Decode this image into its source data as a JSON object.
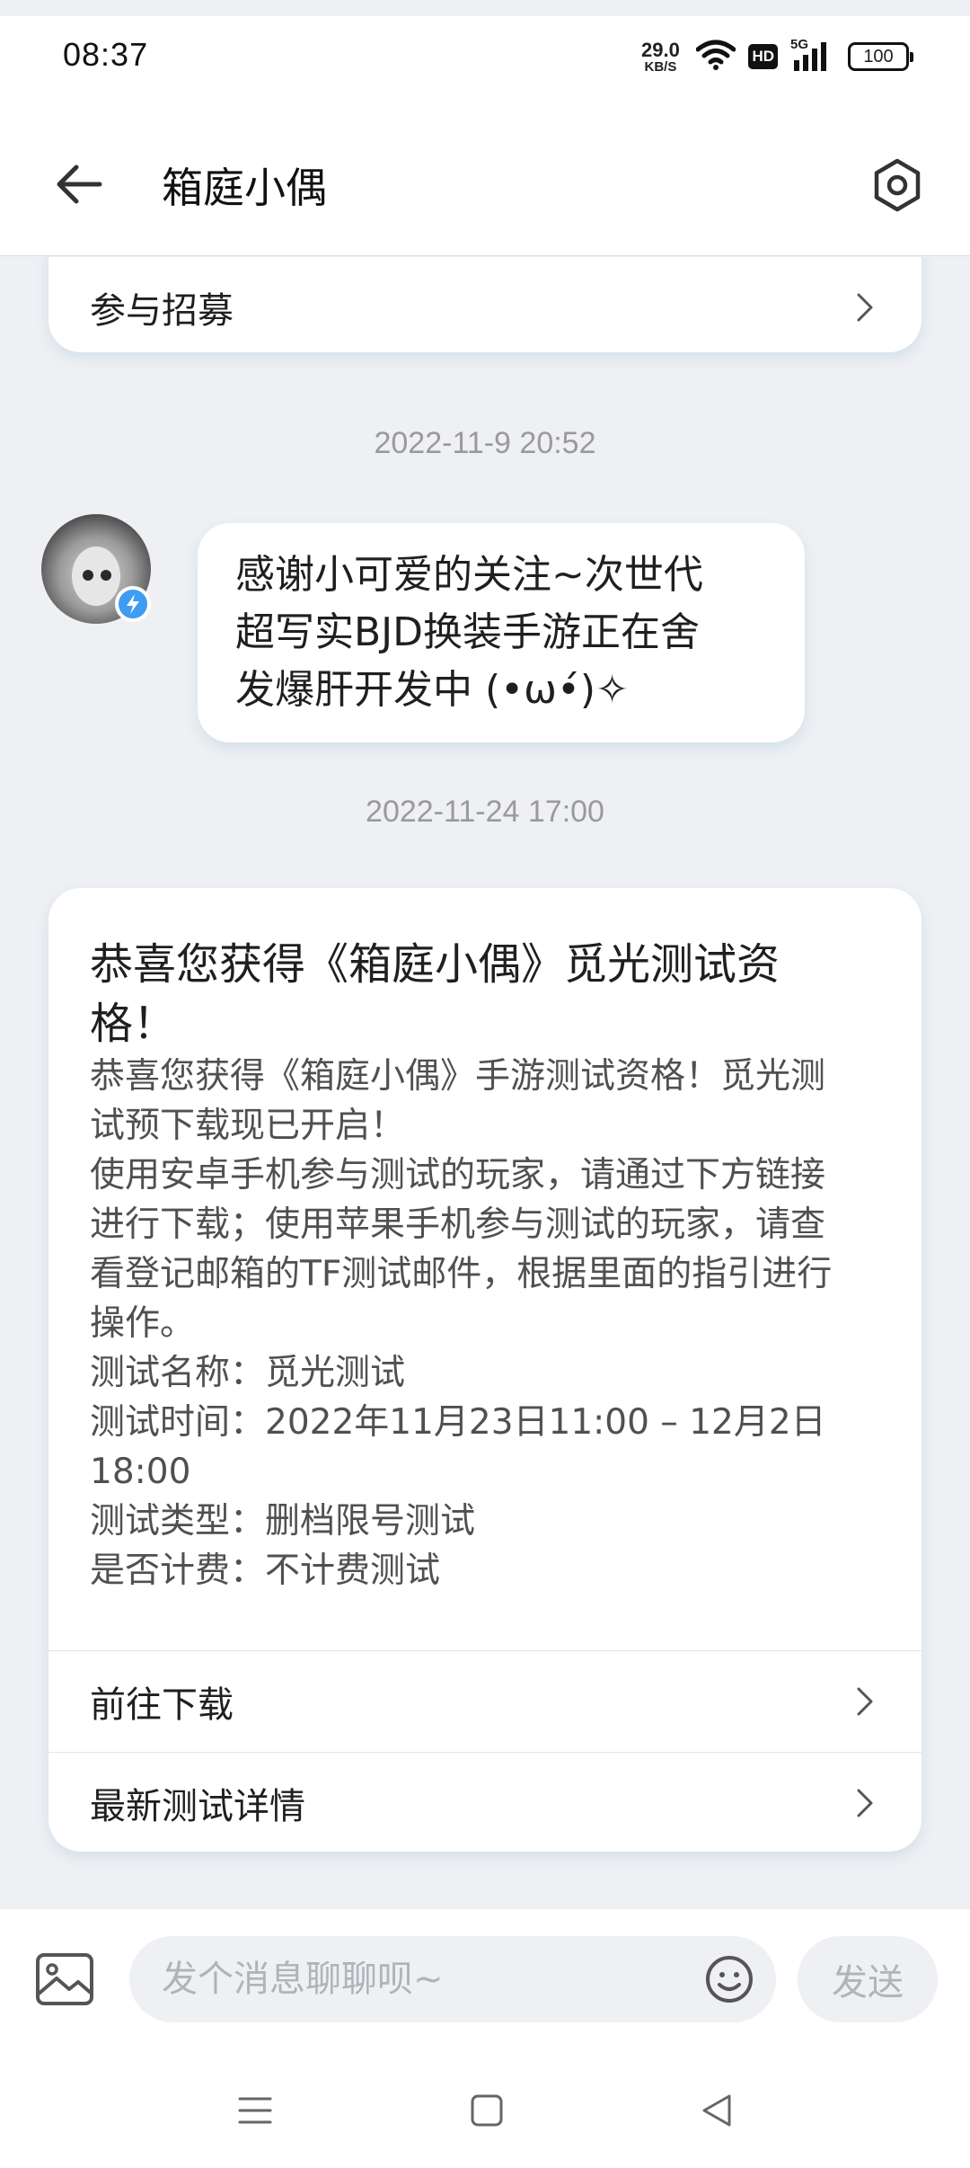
{
  "status_bar": {
    "time": "08:37",
    "net_speed_value": "29.0",
    "net_speed_unit": "KB/S",
    "hd": "HD",
    "network": "5G",
    "battery": "100"
  },
  "header": {
    "title": "箱庭小偶",
    "back_icon": "back-arrow-icon",
    "settings_icon": "hexagon-settings-icon"
  },
  "chat": {
    "top_card": {
      "label": "参与招募"
    },
    "messages": [
      {
        "timestamp": "2022-11-9 20:52",
        "lines": [
          "感谢小可爱的关注~次世代",
          "超写实BJD换装手游正在舍",
          "发爆肝开发中 (•ω•́)✧"
        ]
      }
    ],
    "notice": {
      "timestamp": "2022-11-24 17:00",
      "title_lines": [
        "恭喜您获得《箱庭小偶》觅光测试资",
        "格！"
      ],
      "body_lines": [
        "恭喜您获得《箱庭小偶》手游测试资格！觅光测",
        "试预下载现已开启！",
        "使用安卓手机参与测试的玩家，请通过下方链接",
        "进行下载；使用苹果手机参与测试的玩家，请查",
        "看登记邮箱的TF测试邮件，根据里面的指引进行",
        "操作。",
        "测试名称：觅光测试",
        "测试时间：2022年11月23日11:00 – 12月2日",
        "18:00",
        "测试类型：删档限号测试",
        "是否计费：不计费测试"
      ],
      "actions": [
        {
          "label": "前往下载"
        },
        {
          "label": "最新测试详情"
        }
      ]
    }
  },
  "input_bar": {
    "placeholder": "发个消息聊聊呗~",
    "send_label": "发送"
  },
  "colors": {
    "background": "#eef0f3",
    "card": "#ffffff",
    "muted_text": "#9a9a9a",
    "placeholder": "#b0b3b8",
    "verified": "#3d9cf5"
  }
}
